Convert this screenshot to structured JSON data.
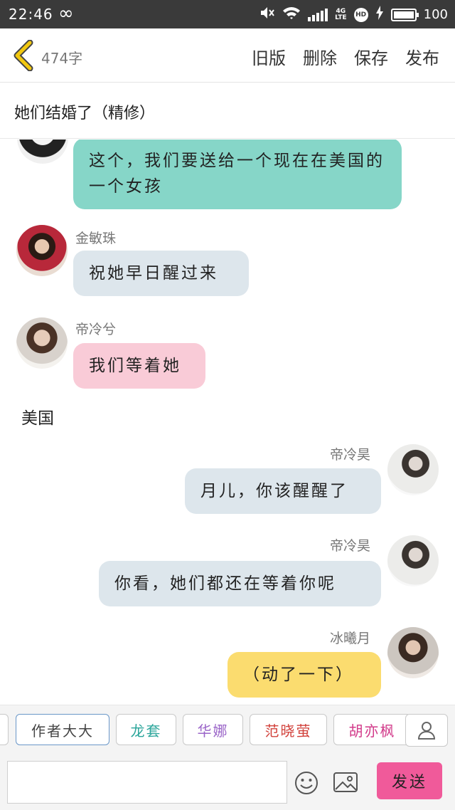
{
  "status_bar": {
    "time": "22:46",
    "network": "4G",
    "network_sub": "LTE",
    "hd": "HD",
    "battery": "100",
    "battery_level": 1.0
  },
  "toolbar": {
    "word_count": "474字",
    "old_version": "旧版",
    "delete": "删除",
    "save": "保存",
    "publish": "发布"
  },
  "story": {
    "title": "她们结婚了（精修）"
  },
  "messages": [
    {
      "side": "left",
      "name": "",
      "text": "这个，我们要送给一个现在在美国的一个女孩",
      "color": "#86d6c8"
    },
    {
      "side": "left",
      "name": "金敏珠",
      "text": "祝她早日醒过来",
      "color": "#dde6ec"
    },
    {
      "side": "left",
      "name": "帝冷兮",
      "text": "我们等着她",
      "color": "#f9cbd7"
    },
    {
      "side": "narration",
      "text": "美国"
    },
    {
      "side": "right",
      "name": "帝冷昊",
      "text": "月儿，你该醒醒了",
      "color": "#dde6ec"
    },
    {
      "side": "right",
      "name": "帝冷昊",
      "text": "你看，她们都还在等着你呢",
      "color": "#dde6ec"
    },
    {
      "side": "right",
      "name": "冰曦月",
      "text": "（动了一下）",
      "color": "#fbdc6f"
    }
  ],
  "characters": [
    {
      "label": "作者大大",
      "color": "#444444"
    },
    {
      "label": "龙套",
      "color": "#2aa59a"
    },
    {
      "label": "华娜",
      "color": "#9a64c8"
    },
    {
      "label": "范晓萤",
      "color": "#d2423c"
    },
    {
      "label": "胡亦枫",
      "color": "#d23a8a"
    }
  ],
  "composer": {
    "placeholder": "",
    "send": "发送"
  },
  "colors": {
    "accent_yellow": "#f2c80f",
    "send_pink": "#f05a9a"
  }
}
